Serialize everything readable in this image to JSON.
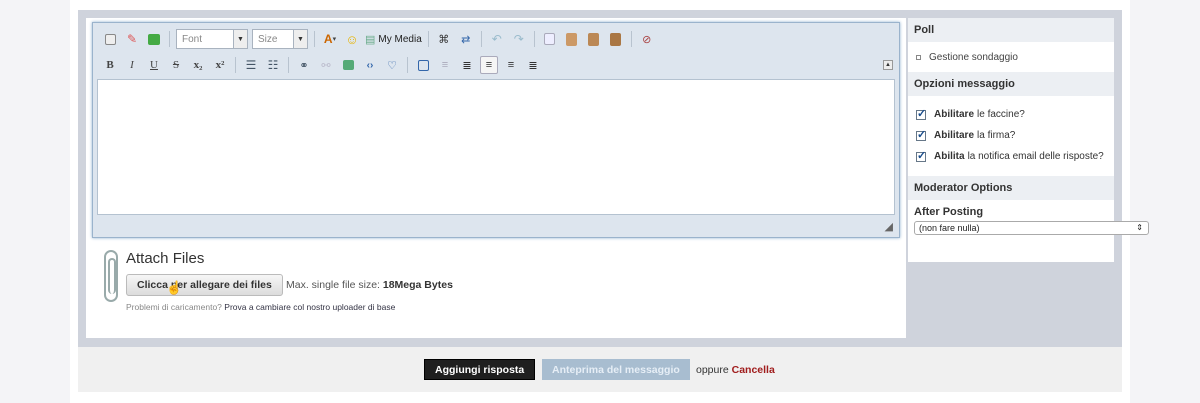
{
  "editor": {
    "font_select": "Font",
    "size_select": "Size",
    "my_media_label": "My Media",
    "format_buttons": [
      "B",
      "I",
      "U",
      "S",
      "x₂",
      "x²"
    ]
  },
  "attach": {
    "title": "Attach Files",
    "button_label": "Clicca per allegare dei files",
    "max_size_prefix": "Max. single file size:",
    "max_size_value": "18Mega Bytes",
    "help_text": "Problemi di caricamento?",
    "help_link": "Prova a cambiare col nostro uploader di base"
  },
  "sidebar": {
    "poll_header": "Poll",
    "poll_item": "Gestione sondaggio",
    "options_header": "Opzioni messaggio",
    "options": [
      {
        "bold": "Abilitare",
        "rest": "le faccine?",
        "checked": true
      },
      {
        "bold": "Abilitare",
        "rest": "la firma?",
        "checked": true
      },
      {
        "bold": "Abilita",
        "rest": "la notifica email delle risposte?",
        "checked": true
      }
    ],
    "moderator_header": "Moderator Options",
    "after_posting_label": "After Posting",
    "after_posting_value": "(non fare nulla)"
  },
  "actions": {
    "submit_label": "Aggiungi risposta",
    "preview_label": "Anteprima del messaggio",
    "or_text": "oppure",
    "cancel_label": "Cancella"
  }
}
